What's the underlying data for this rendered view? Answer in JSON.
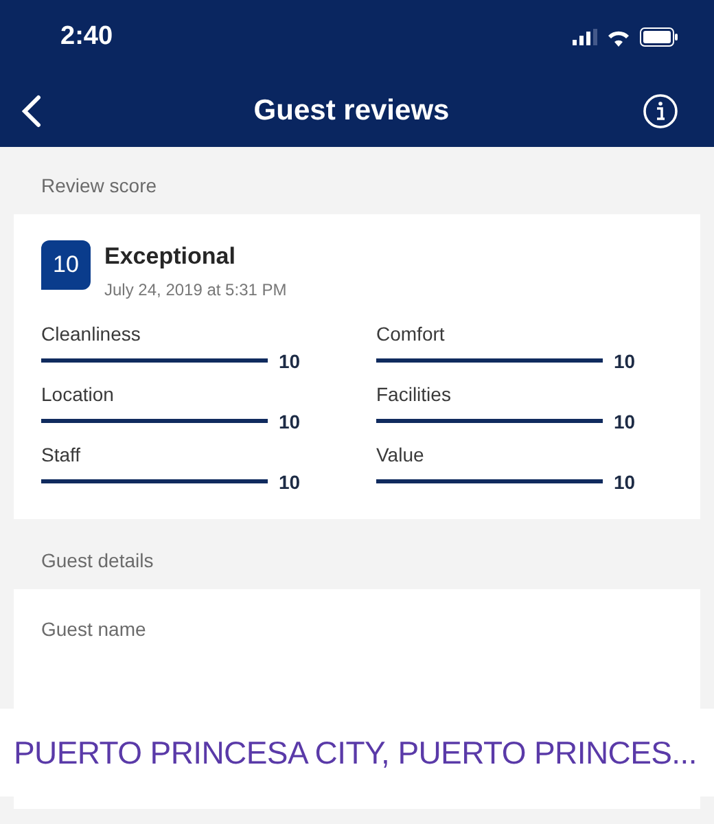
{
  "status_bar": {
    "time": "2:40"
  },
  "header": {
    "title": "Guest reviews"
  },
  "review_score": {
    "heading": "Review score",
    "score": "10",
    "rating": "Exceptional",
    "date": "July 24, 2019 at 5:31 PM",
    "categories": [
      {
        "label": "Cleanliness",
        "level": 1,
        "value": "10"
      },
      {
        "label": "Comfort",
        "level": 1,
        "value": "10"
      },
      {
        "label": "Location",
        "level": 1,
        "value": "10"
      },
      {
        "label": "Facilities",
        "level": 1,
        "value": "10"
      },
      {
        "label": "Staff",
        "level": 1,
        "value": "10"
      },
      {
        "label": "Value",
        "level": 1,
        "value": "10"
      }
    ]
  },
  "guest_details": {
    "heading": "Guest details",
    "field_label": "Guest name"
  },
  "location_sticker": {
    "text": "PUERTO PRINCESA CITY, PUERTO PRINCES..."
  }
}
